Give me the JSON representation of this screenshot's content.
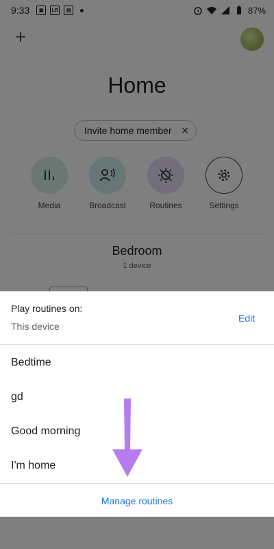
{
  "status_bar": {
    "time": "9:33",
    "left_badges": [
      "LR"
    ],
    "battery": "87%"
  },
  "home": {
    "title": "Home",
    "invite_chip": "Invite home member",
    "actions": [
      {
        "label": "Media",
        "icon": "media-icon",
        "color": "#d6efe3"
      },
      {
        "label": "Broadcast",
        "icon": "broadcast-icon",
        "color": "#cfeff0"
      },
      {
        "label": "Routines",
        "icon": "routines-icon",
        "color": "#e7dcf7"
      },
      {
        "label": "Settings",
        "icon": "gear-icon",
        "color": "#ffffff"
      }
    ],
    "room": {
      "title": "Bedroom",
      "subtitle": "1 device"
    }
  },
  "sheet": {
    "play_label": "Play routines on:",
    "play_device": "This device",
    "edit_label": "Edit",
    "routines": [
      "Bedtime",
      "gd",
      "Good morning",
      "I'm home"
    ],
    "manage_label": "Manage routines"
  },
  "colors": {
    "accent": "#1a73e8",
    "annotation_arrow": "#b77df0"
  }
}
